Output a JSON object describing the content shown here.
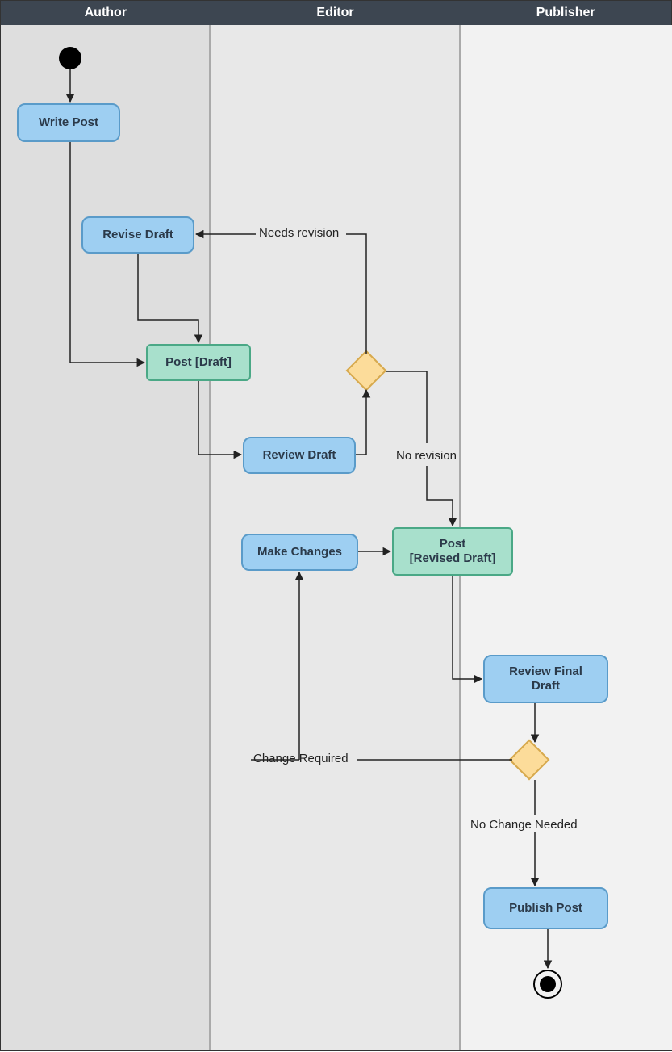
{
  "lanes": {
    "author": "Author",
    "editor": "Editor",
    "publisher": "Publisher"
  },
  "nodes": {
    "write_post": "Write Post",
    "revise_draft": "Revise Draft",
    "post_draft": "Post [Draft]",
    "review_draft": "Review Draft",
    "make_changes": "Make Changes",
    "post_revised": "Post\n[Revised Draft]",
    "review_final": "Review Final\nDraft",
    "publish_post": "Publish Post"
  },
  "edge_labels": {
    "needs_revision": "Needs revision",
    "no_revision": "No revision",
    "change_required": "Change Required",
    "no_change_needed": "No Change Needed"
  },
  "chart_data": {
    "type": "activity-diagram-swimlane",
    "swimlanes": [
      "Author",
      "Editor",
      "Publisher"
    ],
    "nodes": [
      {
        "id": "start",
        "type": "initial",
        "lane": "Author"
      },
      {
        "id": "write_post",
        "type": "activity",
        "lane": "Author",
        "label": "Write Post"
      },
      {
        "id": "revise_draft",
        "type": "activity",
        "lane": "Author",
        "label": "Revise Draft"
      },
      {
        "id": "post_draft",
        "type": "object",
        "lane": "Author",
        "label": "Post [Draft]"
      },
      {
        "id": "review_draft",
        "type": "activity",
        "lane": "Editor",
        "label": "Review Draft"
      },
      {
        "id": "decision1",
        "type": "decision",
        "lane": "Editor"
      },
      {
        "id": "make_changes",
        "type": "activity",
        "lane": "Editor",
        "label": "Make Changes"
      },
      {
        "id": "post_revised",
        "type": "object",
        "lane": "Editor",
        "label": "Post [Revised Draft]"
      },
      {
        "id": "review_final",
        "type": "activity",
        "lane": "Publisher",
        "label": "Review Final Draft"
      },
      {
        "id": "decision2",
        "type": "decision",
        "lane": "Publisher"
      },
      {
        "id": "publish_post",
        "type": "activity",
        "lane": "Publisher",
        "label": "Publish Post"
      },
      {
        "id": "end",
        "type": "final",
        "lane": "Publisher"
      }
    ],
    "edges": [
      {
        "from": "start",
        "to": "write_post"
      },
      {
        "from": "write_post",
        "to": "post_draft"
      },
      {
        "from": "revise_draft",
        "to": "post_draft"
      },
      {
        "from": "post_draft",
        "to": "review_draft"
      },
      {
        "from": "review_draft",
        "to": "decision1"
      },
      {
        "from": "decision1",
        "to": "revise_draft",
        "label": "Needs revision"
      },
      {
        "from": "decision1",
        "to": "post_revised",
        "label": "No revision"
      },
      {
        "from": "make_changes",
        "to": "post_revised"
      },
      {
        "from": "post_revised",
        "to": "review_final"
      },
      {
        "from": "review_final",
        "to": "decision2"
      },
      {
        "from": "decision2",
        "to": "make_changes",
        "label": "Change Required"
      },
      {
        "from": "decision2",
        "to": "publish_post",
        "label": "No Change Needed"
      },
      {
        "from": "publish_post",
        "to": "end"
      }
    ]
  }
}
